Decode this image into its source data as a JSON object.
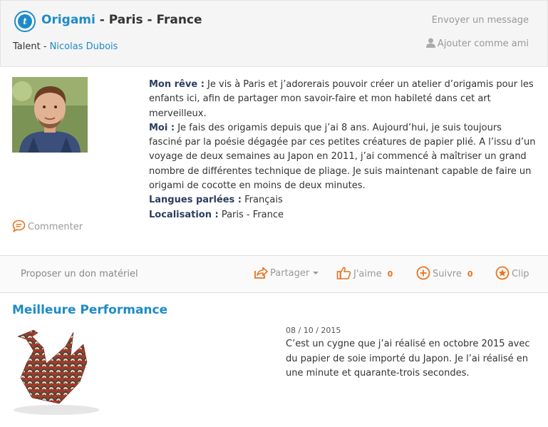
{
  "header": {
    "category": "Origami",
    "location": " - Paris - France",
    "talent_label": "Talent - ",
    "talent_name": "Nicolas Dubois",
    "send_message": "Envoyer un message",
    "add_friend": "Ajouter comme ami"
  },
  "bio": {
    "dream_label": "Mon rêve :",
    "dream_text": " Je vis à Paris et j’adorerais pouvoir créer un atelier d’origamis pour les enfants ici, afin de partager mon savoir-faire et mon habileté dans cet art merveilleux.",
    "me_label": "Moi :",
    "me_text": " Je fais des origamis depuis que j’ai 8 ans. Aujourd’hui, je suis toujours fasciné par la poésie dégagée par ces petites créatures de papier plié. A l’issu d’un voyage de deux semaines au Japon en 2011, j’ai commencé à maîtriser un grand nombre de différentes technique de pliage. Je suis maintenant capable de faire un origami de cocotte en moins de deux minutes.",
    "languages_label": "Langues parlées :",
    "languages_value": " Français",
    "location_label": "Localisation :",
    "location_value": " Paris - France"
  },
  "comment_label": "Commenter",
  "actions": {
    "donate": "Proposer un don matériel",
    "share": "Partager",
    "like": "J'aime",
    "like_count": "0",
    "follow": "Suivre",
    "follow_count": "0",
    "clip": "Clip"
  },
  "performance": {
    "title": "Meilleure Performance",
    "date": "08 / 10 / 2015",
    "description": "C’est un cygne que j’ai réalisé en octobre 2015 avec du papier de soie importé du Japon. Je l’ai réalisé en une minute et quarante-trois secondes."
  },
  "colors": {
    "brand": "#1d8bc9",
    "accent": "#e8731f",
    "label": "#2c3e60"
  }
}
